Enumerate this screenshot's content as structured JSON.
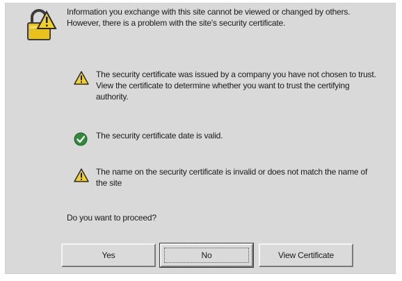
{
  "dialog": {
    "intro": "Information you exchange with this site cannot be viewed or changed by others. However, there is a problem with the site's security certificate.",
    "items": [
      {
        "icon": "warning-icon",
        "text": "The security certificate was issued by a company you have not chosen to trust. View the certificate to determine whether you want to trust the certifying authority."
      },
      {
        "icon": "check-icon",
        "text": "The security certificate date is valid."
      },
      {
        "icon": "warning-icon",
        "text": "The name on the security certificate is invalid or does not match the name of the site"
      }
    ],
    "question": "Do you want to proceed?",
    "buttons": {
      "yes": "Yes",
      "no": "No",
      "view_certificate": "View Certificate"
    }
  },
  "colors": {
    "dialog_bg": "#d9d9d9",
    "warning_yellow": "#f2d21f",
    "check_green": "#2e8b3a"
  }
}
